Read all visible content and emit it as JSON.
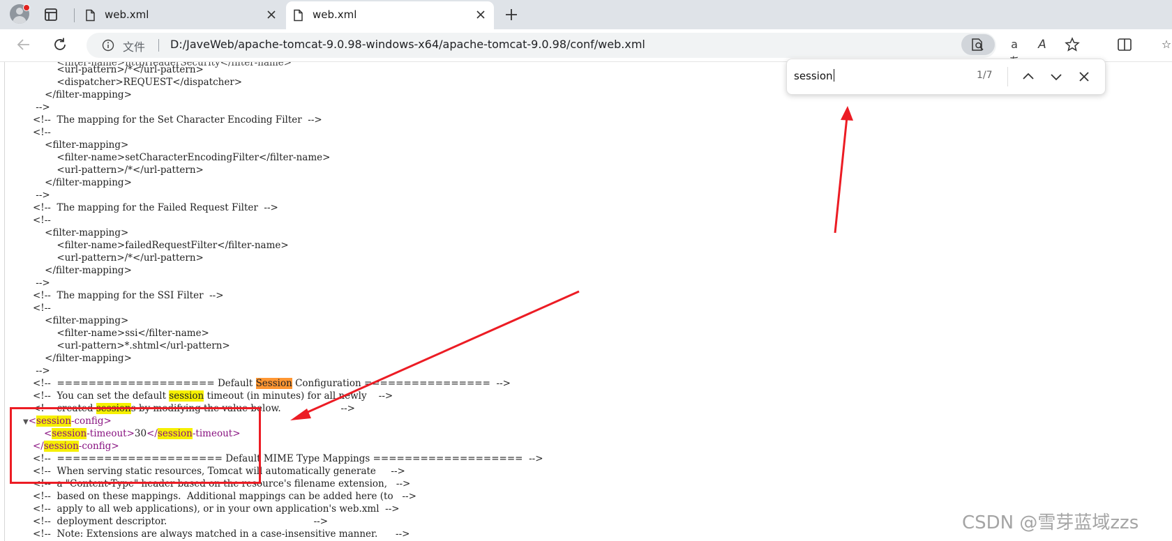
{
  "browser": {
    "tabs": [
      {
        "label": "web.xml",
        "active": false
      },
      {
        "label": "web.xml",
        "active": true
      }
    ],
    "address": {
      "scheme": "文件",
      "url": "D:/JaveWeb/apache-tomcat-9.0.98-windows-x64/apache-tomcat-9.0.98/conf/web.xml"
    },
    "icons": [
      "profile-icon",
      "tab-manager-icon",
      "document-icon",
      "close-icon",
      "new-tab-icon",
      "back-icon",
      "refresh-icon",
      "info-icon",
      "find-in-page-icon",
      "translate-icon",
      "read-aloud-icon",
      "favorite-star-icon",
      "split-screen-icon",
      "favorites-icon"
    ],
    "translate_icon_text": "aあ",
    "read_aloud_icon_text": "A",
    "favorites_icon_text": "☆"
  },
  "find_bar": {
    "query": "session",
    "count": "1/7"
  },
  "xml_lines": [
    "        <url-pattern>/*</url-pattern>",
    "        <dispatcher>REQUEST</dispatcher>",
    "    </filter-mapping>",
    " -->",
    "<!--  The mapping for the Set Character Encoding Filter  -->",
    "<!--",
    "    <filter-mapping>",
    "        <filter-name>setCharacterEncodingFilter</filter-name>",
    "        <url-pattern>/*</url-pattern>",
    "    </filter-mapping>",
    " -->",
    "<!--  The mapping for the Failed Request Filter  -->",
    "<!--",
    "    <filter-mapping>",
    "        <filter-name>failedRequestFilter</filter-name>",
    "        <url-pattern>/*</url-pattern>",
    "    </filter-mapping>",
    " -->",
    "<!--  The mapping for the SSI Filter  -->",
    "<!--",
    "    <filter-mapping>",
    "        <filter-name>ssi</filter-name>",
    "        <url-pattern>*.shtml</url-pattern>",
    "    </filter-mapping>",
    " -->"
  ],
  "session_block": {
    "comment1_a": "<!--  ==================== Default ",
    "comment1_hl": "Session",
    "comment1_b": " Configuration ================  -->",
    "comment2_a": "<!--  You can set the default ",
    "comment2_hl": "session",
    "comment2_b": " timeout (in minutes) for all newly    -->",
    "comment3_a": "<!--  created ",
    "comment3_hl": "session",
    "comment3_b": "s by modifying the value below.                    -->",
    "open_lt": "<",
    "open_hl": "session",
    "open_rest": "-config>",
    "timeout_lt": "<",
    "timeout_hl1": "session",
    "timeout_mid": "-timeout>",
    "timeout_value": "30",
    "timeout_lt2": "</",
    "timeout_hl2": "session",
    "timeout_end": "-timeout>",
    "close_lt": "</",
    "close_hl": "session",
    "close_rest": "-config>"
  },
  "tail_lines": [
    "<!--  ===================== Default MIME Type Mappings ===================  -->",
    "<!--  When serving static resources, Tomcat will automatically generate     -->",
    "<!--  a \"Content-Type\" header based on the resource's filename extension,   -->",
    "<!--  based on these mappings.  Additional mappings can be added here (to   -->",
    "<!--  apply to all web applications), or in your own application's web.xml  -->",
    "<!--  deployment descriptor.                                                 -->",
    "<!--  Note: Extensions are always matched in a case-insensitive manner.      -->"
  ],
  "top_partial_line": "        <filter-name>httpHeaderSecurity</filter-name>",
  "watermark": "CSDN @雪芽蓝域zzs",
  "colors": {
    "annotation_red": "#ec1c24",
    "highlight": "#f6f000",
    "current_highlight": "#ff9632",
    "tag_purple": "#881280"
  }
}
